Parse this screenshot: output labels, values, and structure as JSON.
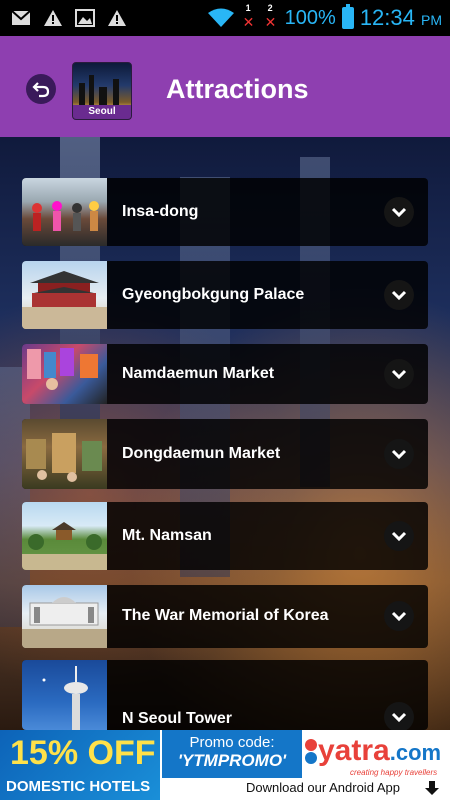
{
  "status_bar": {
    "battery_percent": "100%",
    "time": "12:34",
    "am_pm": "PM",
    "sim1_number": "1",
    "sim2_number": "2",
    "icons": [
      "gmail-icon",
      "warning-icon",
      "image-icon",
      "warning-icon",
      "wifi-icon",
      "battery-icon"
    ]
  },
  "header": {
    "title": "Attractions",
    "city_label": "Seoul",
    "accent_color": "#8e3fb0"
  },
  "attractions": [
    {
      "name": "Insa-dong"
    },
    {
      "name": "Gyeongbokgung Palace"
    },
    {
      "name": "Namdaemun Market"
    },
    {
      "name": "Dongdaemun Market"
    },
    {
      "name": "Mt. Namsan"
    },
    {
      "name": "The War Memorial of Korea"
    },
    {
      "name": "N Seoul Tower"
    }
  ],
  "ad": {
    "discount": "15% OFF",
    "subtitle": "DOMESTIC HOTELS",
    "promo_line1": "Promo code:",
    "promo_code": "'YTMPROMO'",
    "brand": "yatra",
    "brand_suffix": ".com",
    "tagline": "creating happy travellers",
    "download_text": "Download our Android App"
  }
}
